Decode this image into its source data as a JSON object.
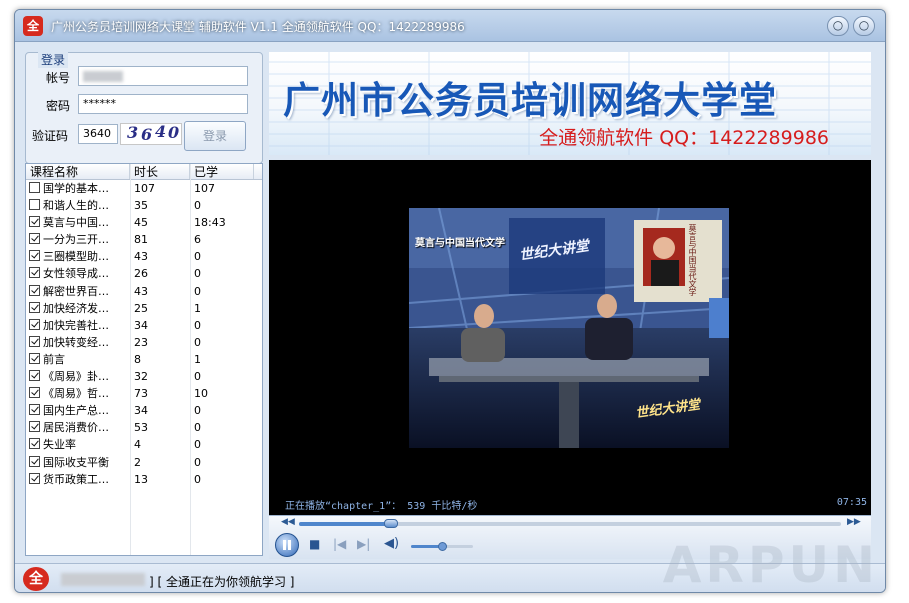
{
  "window": {
    "title": "广州公务员培训网络大课堂 辅助软件 V1.1 全通领航软件 QQ：1422289986",
    "icon_text": "全"
  },
  "login": {
    "legend": "登录",
    "account_label": "帐号",
    "password_label": "密码",
    "password_value": "******",
    "captcha_label": "验证码",
    "captcha_input": "3640",
    "captcha_image_chars": [
      "3",
      "6",
      "4",
      "0"
    ],
    "login_button": "登录"
  },
  "banner": {
    "title": "广州市公务员培训网络大学堂",
    "subtitle": "全通领航软件 QQ：1422289986"
  },
  "course_list": {
    "headers": [
      "课程名称",
      "时长",
      "已学"
    ],
    "rows": [
      {
        "checked": false,
        "name": "国学的基本…",
        "duration": "107",
        "learned": "107"
      },
      {
        "checked": false,
        "name": "和谐人生的…",
        "duration": "35",
        "learned": "0"
      },
      {
        "checked": true,
        "name": "莫言与中国…",
        "duration": "45",
        "learned": "18:43"
      },
      {
        "checked": true,
        "name": "一分为三开…",
        "duration": "81",
        "learned": "6"
      },
      {
        "checked": true,
        "name": "三圈模型助…",
        "duration": "43",
        "learned": "0"
      },
      {
        "checked": true,
        "name": "女性领导成…",
        "duration": "26",
        "learned": "0"
      },
      {
        "checked": true,
        "name": "解密世界百…",
        "duration": "43",
        "learned": "0"
      },
      {
        "checked": true,
        "name": "加快经济发…",
        "duration": "25",
        "learned": "1"
      },
      {
        "checked": true,
        "name": "加快完善社…",
        "duration": "34",
        "learned": "0"
      },
      {
        "checked": true,
        "name": "加快转变经…",
        "duration": "23",
        "learned": "0"
      },
      {
        "checked": true,
        "name": "前言",
        "duration": "8",
        "learned": "1"
      },
      {
        "checked": true,
        "name": "《周易》卦…",
        "duration": "32",
        "learned": "0"
      },
      {
        "checked": true,
        "name": "《周易》哲…",
        "duration": "73",
        "learned": "10"
      },
      {
        "checked": true,
        "name": "国内生产总…",
        "duration": "34",
        "learned": "0"
      },
      {
        "checked": true,
        "name": "居民消费价…",
        "duration": "53",
        "learned": "0"
      },
      {
        "checked": true,
        "name": "失业率",
        "duration": "4",
        "learned": "0"
      },
      {
        "checked": true,
        "name": "国际收支平衡",
        "duration": "2",
        "learned": "0"
      },
      {
        "checked": true,
        "name": "货币政策工…",
        "duration": "13",
        "learned": "0"
      }
    ]
  },
  "video": {
    "caption": "莫言与中国当代文学",
    "show_logo": "世纪大讲堂",
    "book_text": "莫言与中国当代文学"
  },
  "player": {
    "status": "正在播放“chapter_1”： 539 千比特/秒",
    "time": "07:35",
    "seek_progress": 0.17,
    "volume_level": 0.5
  },
  "statusbar": {
    "message": "] [ 全通正在为你领航学习 ]"
  },
  "watermark": "ARPUN"
}
